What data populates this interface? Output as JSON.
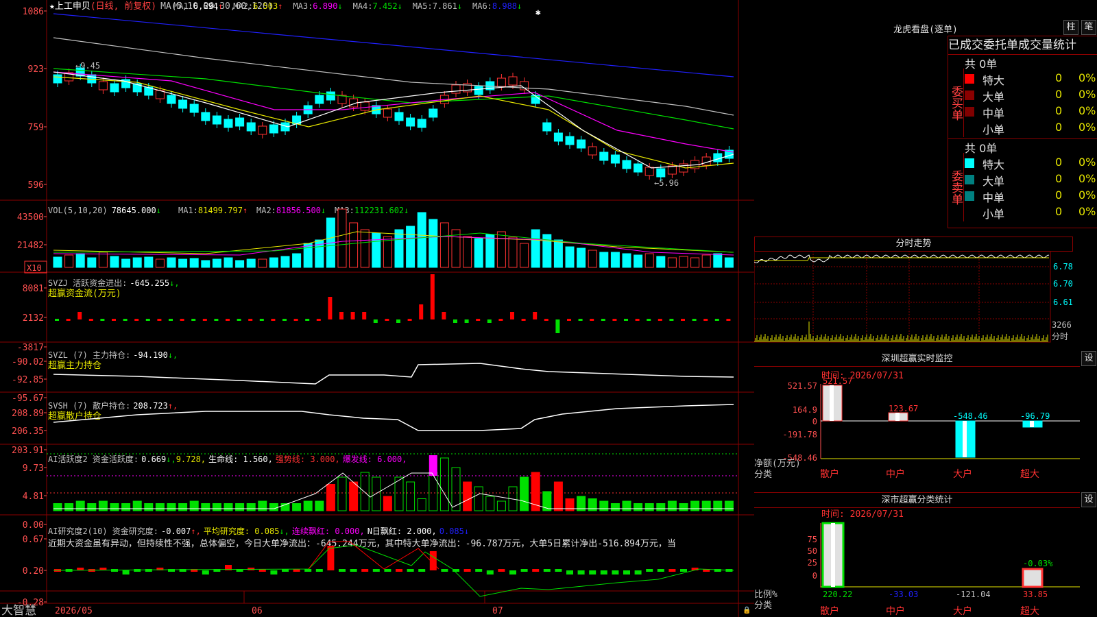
{
  "colors": {
    "up": "#ff3232",
    "down": "#00ffff",
    "grid": "#8b0000",
    "green": "#00e000",
    "yellow": "#e6e600",
    "magenta": "#ff00ff",
    "white": "#ffffff",
    "blue": "#2020ff",
    "gray": "#c0c0c0",
    "redtext": "#ff4040",
    "axis": "#ff5050"
  },
  "main": {
    "title": "★上工申贝",
    "period": "(日线, 前复权)",
    "ma_label": "MA(5,10,20,30,60,120)",
    "ma": [
      {
        "label": "MA1:",
        "value": "6.694",
        "arrow": "↑",
        "color": "#ffffff"
      },
      {
        "label": "MA2:",
        "value": "6.503",
        "arrow": "↑",
        "color": "#e6e600"
      },
      {
        "label": "MA3:",
        "value": "6.890",
        "arrow": "↓",
        "color": "#ff00ff"
      },
      {
        "label": "MA4:",
        "value": "7.452",
        "arrow": "↓",
        "color": "#00e000"
      },
      {
        "label": "MA5:",
        "value": "7.861",
        "arrow": "↓",
        "color": "#c0c0c0"
      },
      {
        "label": "MA6:",
        "value": "8.988",
        "arrow": "↓",
        "color": "#2020ff"
      }
    ],
    "y_ticks": [
      "1086",
      "923",
      "759",
      "596"
    ],
    "high_label": "←9.45",
    "low_label": "←5.96",
    "ylim": [
      5.4,
      11.2
    ]
  },
  "vol": {
    "label": "VOL(5,10,20)",
    "value": "78645.000",
    "arrow": "↓",
    "ma": [
      {
        "label": "MA1:",
        "value": "81499.797",
        "arrow": "↑",
        "color": "#e6e600"
      },
      {
        "label": "MA2:",
        "value": "81856.500",
        "arrow": "↓",
        "color": "#ff00ff"
      },
      {
        "label": "MA3:",
        "value": "112231.602",
        "arrow": "↓",
        "color": "#00e000"
      }
    ],
    "y_ticks": [
      "43500",
      "21482"
    ],
    "unit": "X10"
  },
  "svzj": {
    "label": "SVZJ  活跃资金进出:",
    "value": "-645.255",
    "arrow": "↓,",
    "sub": "超赢资金流(万元)",
    "y_ticks": [
      "8081",
      "2132",
      "-3817"
    ]
  },
  "svzl": {
    "label": "SVZL (7) 主力持仓:",
    "value": "-94.190",
    "arrow": "↓,",
    "sub": "超赢主力持仓",
    "y_ticks": [
      "-90.02",
      "-92.85",
      "-95.67"
    ]
  },
  "svsh": {
    "label": "SVSH (7) 散户持仓:",
    "value": "208.723",
    "arrow": "↑,",
    "sub": "超赢散户持仓",
    "y_ticks": [
      "208.89",
      "206.35",
      "203.91"
    ]
  },
  "ai1": {
    "label": "AI活跃度2 资金活跃度:",
    "value": "0.669",
    "arrow": "↓,",
    "v2": "9.728,",
    "life": "生命线: 1.560,",
    "strong": "强势线: 3.000,",
    "burst": "爆发线: 6.000,",
    "y_ticks": [
      "9.73",
      "4.81",
      "0.00"
    ]
  },
  "ai2": {
    "label": "AI研究度2(10) 资金研究度:",
    "value": "-0.007",
    "arrow": "↑,",
    "avg": "平均研究度: 0.085",
    "avg_arrow": "↓,",
    "cont": "连续飘红: 0.000,",
    "nday": "N日飘红: 2.000,",
    "last": "0.085↓",
    "text": "近期大资金虽有异动，但持续性不强，总体偏空，今日大单净流出：-645.244万元，其中特大单净流出：-96.787万元，大单5日累计净出-516.894万元，当",
    "y_ticks": [
      "0.67",
      "0.20",
      "-0.28"
    ]
  },
  "xaxis": {
    "brand": "大智慧",
    "labels": [
      "2026/05",
      "06",
      "07"
    ]
  },
  "dragon": {
    "title": "龙虎看盘(逐单)",
    "btn1": "柱",
    "btn2": "笔",
    "tabs": "已成交委托单成交量统计",
    "buy": {
      "side": "委买单",
      "total": "共 0单",
      "rows": [
        {
          "name": "特大",
          "count": "0",
          "pct": "0%",
          "color": "#ff0000"
        },
        {
          "name": "大单",
          "count": "0",
          "pct": "0%",
          "color": "#8b0000"
        },
        {
          "name": "中单",
          "count": "0",
          "pct": "0%",
          "color": "#800000"
        },
        {
          "name": "小单",
          "count": "0",
          "pct": "0%",
          "color": "#000000"
        }
      ]
    },
    "sell": {
      "side": "委卖单",
      "total": "共 0单",
      "rows": [
        {
          "name": "特大",
          "count": "0",
          "pct": "0%",
          "color": "#00ffff"
        },
        {
          "name": "大单",
          "count": "0",
          "pct": "0%",
          "color": "#008080"
        },
        {
          "name": "中单",
          "count": "0",
          "pct": "0%",
          "color": "#008080"
        },
        {
          "name": "小单",
          "count": "0",
          "pct": "0%",
          "color": "#000000"
        }
      ]
    }
  },
  "fenshi": {
    "title": "分时走势",
    "y_ticks": [
      "6.78",
      "6.70",
      "6.61"
    ],
    "vol_tick": "3266",
    "vol_unit": "分时"
  },
  "monitor": {
    "title": "深圳超赢实时监控",
    "set": "设",
    "time": "时间: 2026/07/31",
    "y_ticks": [
      "521.57",
      "164.9",
      "0",
      "-191.78",
      "-548.46"
    ],
    "ylabel1": "净额(万元)",
    "ylabel2": "分类",
    "categories": [
      "散户",
      "中户",
      "大户",
      "超大"
    ],
    "values": [
      521.57,
      123.67,
      -548.46,
      -96.79
    ],
    "value_labels": [
      "521.57",
      "123.67",
      "-548.46",
      "-96.79"
    ]
  },
  "stats": {
    "title": "深市超赢分类统计",
    "set": "设",
    "time": "时间: 2026/07/31",
    "y_ticks": [
      "75",
      "50",
      "25",
      "0"
    ],
    "ylabel1": "比例%",
    "ylabel2": "分类",
    "categories": [
      "散户",
      "中户",
      "大户",
      "超大"
    ],
    "bar_values": [
      220.22,
      0,
      0,
      33.85
    ],
    "pct_label": "-0.03%",
    "value_labels": [
      "220.22",
      "-33.03",
      "-121.04",
      "33.85"
    ]
  }
}
